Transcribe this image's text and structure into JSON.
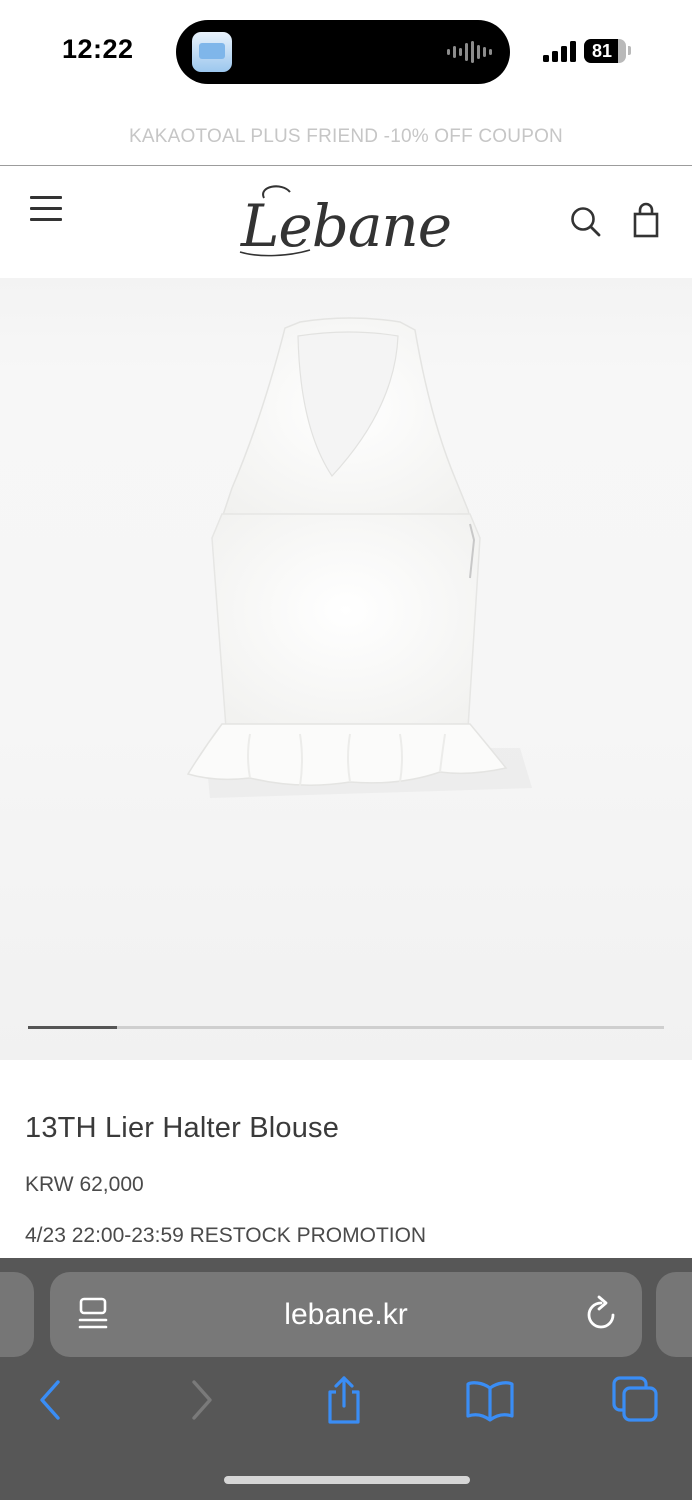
{
  "status_bar": {
    "time": "12:22",
    "battery_level": "81",
    "battery_fraction": 0.81,
    "island_activity": "app-preview-and-audio-waveform"
  },
  "promo_banner": {
    "text": "KAKAOTOAL PLUS FRIEND -10% OFF COUPON"
  },
  "header": {
    "logo_text": "Lebane",
    "icons": [
      "menu-icon",
      "search-icon",
      "shopping-bag-icon"
    ]
  },
  "product": {
    "title": "13TH Lier Halter Blouse",
    "price": "KRW 62,000",
    "promotion": "4/23 22:00-23:59 RESTOCK PROMOTION",
    "image_description_icon": "white-halter-blouse-image",
    "carousel_progress": 0.14
  },
  "browser": {
    "url": "lebane.kr",
    "icons": [
      "reader-icon",
      "reload-icon",
      "back-icon",
      "forward-icon",
      "share-icon",
      "bookmarks-icon",
      "tabs-icon"
    ],
    "forward_enabled": false
  },
  "colors": {
    "toolbar_bg": "#575757",
    "address_bar_bg": "#787878",
    "ios_blue": "#3a8df5",
    "promo_text": "#c6c6c6"
  }
}
